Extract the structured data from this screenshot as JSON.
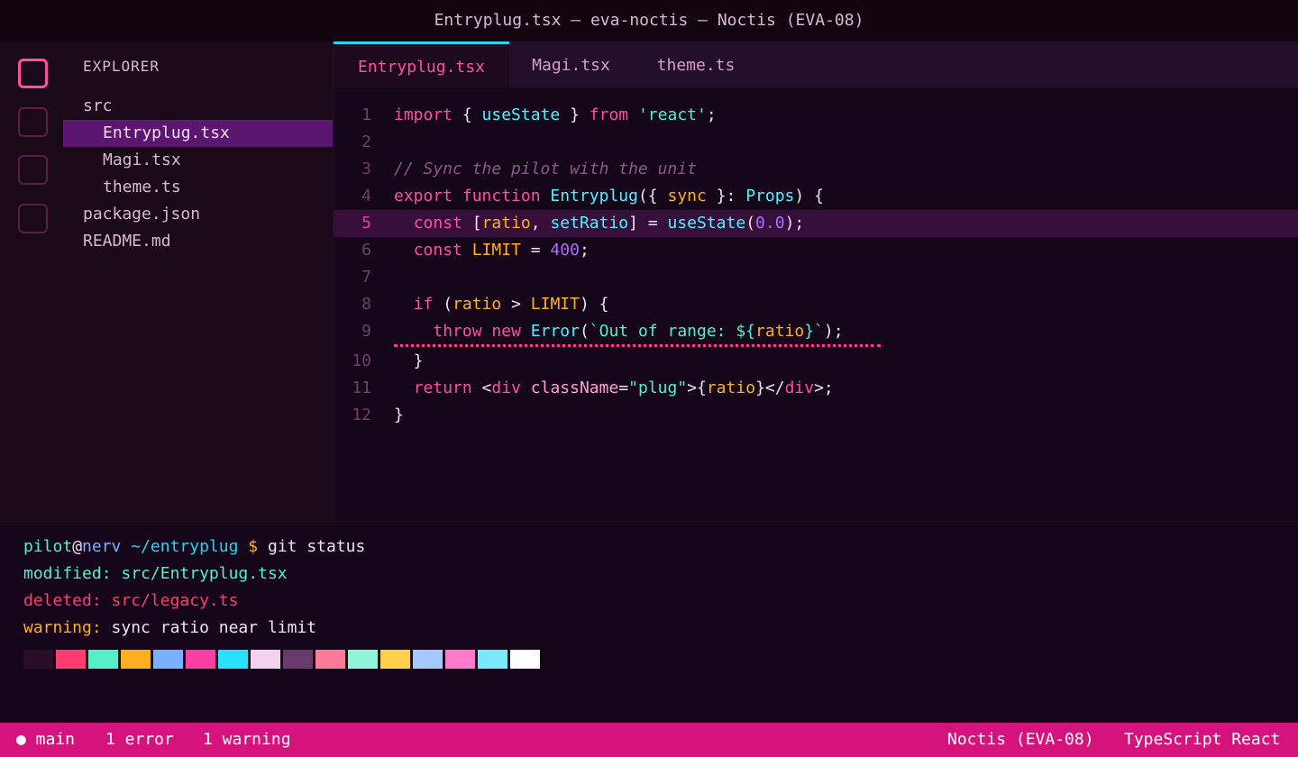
{
  "window": {
    "title": "Entryplug.tsx — eva-noctis — Noctis (EVA-08)"
  },
  "sidebar": {
    "title": "EXPLORER",
    "items": [
      {
        "label": "src"
      },
      {
        "label": "Entryplug.tsx"
      },
      {
        "label": "Magi.tsx"
      },
      {
        "label": "theme.ts"
      },
      {
        "label": "package.json"
      },
      {
        "label": "README.md"
      }
    ]
  },
  "tabs": [
    {
      "label": "Entryplug.tsx"
    },
    {
      "label": "Magi.tsx"
    },
    {
      "label": "theme.ts"
    }
  ],
  "editor": {
    "lines": [
      {
        "n": "1",
        "tokens": [
          [
            "kw",
            "import"
          ],
          [
            "pun",
            " { "
          ],
          [
            "fn",
            "useState"
          ],
          [
            "pun",
            " } "
          ],
          [
            "kw",
            "from"
          ],
          [
            "pun",
            " "
          ],
          [
            "str",
            "'react'"
          ],
          [
            "pun",
            ";"
          ]
        ]
      },
      {
        "n": "2",
        "tokens": []
      },
      {
        "n": "3",
        "tokens": [
          [
            "cmt",
            "// Sync the pilot with the unit"
          ]
        ]
      },
      {
        "n": "4",
        "tokens": [
          [
            "kw",
            "export"
          ],
          [
            "pun",
            " "
          ],
          [
            "kw",
            "function"
          ],
          [
            "pun",
            " "
          ],
          [
            "fn",
            "Entryplug"
          ],
          [
            "pun",
            "({ "
          ],
          [
            "var",
            "sync"
          ],
          [
            "pun",
            " }: "
          ],
          [
            "fn",
            "Props"
          ],
          [
            "pun",
            ") {"
          ]
        ]
      },
      {
        "n": "5",
        "tokens": [
          [
            "pun",
            "  "
          ],
          [
            "kw",
            "const"
          ],
          [
            "pun",
            " ["
          ],
          [
            "var",
            "ratio"
          ],
          [
            "pun",
            ", "
          ],
          [
            "fn",
            "setRatio"
          ],
          [
            "pun",
            "] = "
          ],
          [
            "fn",
            "useState"
          ],
          [
            "pun",
            "("
          ],
          [
            "num",
            "0.0"
          ],
          [
            "pun",
            ");"
          ]
        ]
      },
      {
        "n": "6",
        "tokens": [
          [
            "pun",
            "  "
          ],
          [
            "kw",
            "const"
          ],
          [
            "pun",
            " "
          ],
          [
            "var",
            "LIMIT"
          ],
          [
            "pun",
            " = "
          ],
          [
            "num",
            "400"
          ],
          [
            "pun",
            ";"
          ]
        ]
      },
      {
        "n": "7",
        "tokens": []
      },
      {
        "n": "8",
        "tokens": [
          [
            "pun",
            "  "
          ],
          [
            "kw",
            "if"
          ],
          [
            "pun",
            " ("
          ],
          [
            "var",
            "ratio"
          ],
          [
            "pun",
            " > "
          ],
          [
            "var",
            "LIMIT"
          ],
          [
            "pun",
            ") {"
          ]
        ]
      },
      {
        "n": "9",
        "tokens": [
          [
            "pun",
            "    "
          ],
          [
            "kw",
            "throw"
          ],
          [
            "pun",
            " "
          ],
          [
            "kw",
            "new"
          ],
          [
            "pun",
            " "
          ],
          [
            "fn",
            "Error"
          ],
          [
            "pun",
            "("
          ],
          [
            "str",
            "`Out of range: ${"
          ],
          [
            "var",
            "ratio"
          ],
          [
            "str",
            "}`"
          ],
          [
            "pun",
            ");"
          ]
        ]
      },
      {
        "n": "10",
        "tokens": [
          [
            "pun",
            "  }"
          ]
        ]
      },
      {
        "n": "11",
        "tokens": [
          [
            "pun",
            "  "
          ],
          [
            "kw",
            "return"
          ],
          [
            "pun",
            " <"
          ],
          [
            "tag",
            "div"
          ],
          [
            "pun",
            " "
          ],
          [
            "attr",
            "className"
          ],
          [
            "pun",
            "="
          ],
          [
            "str",
            "\"plug\""
          ],
          [
            "pun",
            ">{"
          ],
          [
            "var",
            "ratio"
          ],
          [
            "pun",
            "}</"
          ],
          [
            "tag",
            "div"
          ],
          [
            "pun",
            ">;"
          ]
        ]
      },
      {
        "n": "12",
        "tokens": [
          [
            "pun",
            "}"
          ]
        ]
      }
    ]
  },
  "terminal": {
    "user": "pilot",
    "at": "@",
    "host": "nerv",
    "path": "~/entryplug",
    "prompt": "$",
    "command": "git status",
    "modified_label": "modified:",
    "modified_file": "src/Entryplug.tsx",
    "deleted_label": "deleted:",
    "deleted_file": "src/legacy.ts",
    "warning_label": "warning:",
    "warning_text": "sync ratio near limit",
    "palette": [
      "#2a0d26",
      "#ff3e6f",
      "#55f0c8",
      "#ffb020",
      "#7ab0ff",
      "#ff3ea5",
      "#2ae0ff",
      "#f2d3ec",
      "#6a3a6a",
      "#ff7a95",
      "#8ff5d6",
      "#ffd04a",
      "#a7c8ff",
      "#ff7ac8",
      "#7ae9ff",
      "#ffffff"
    ]
  },
  "statusbar": {
    "branch": "● main",
    "errors": "1 error",
    "warnings": "1 warning",
    "theme": "Noctis (EVA-08)",
    "language": "TypeScript React"
  }
}
